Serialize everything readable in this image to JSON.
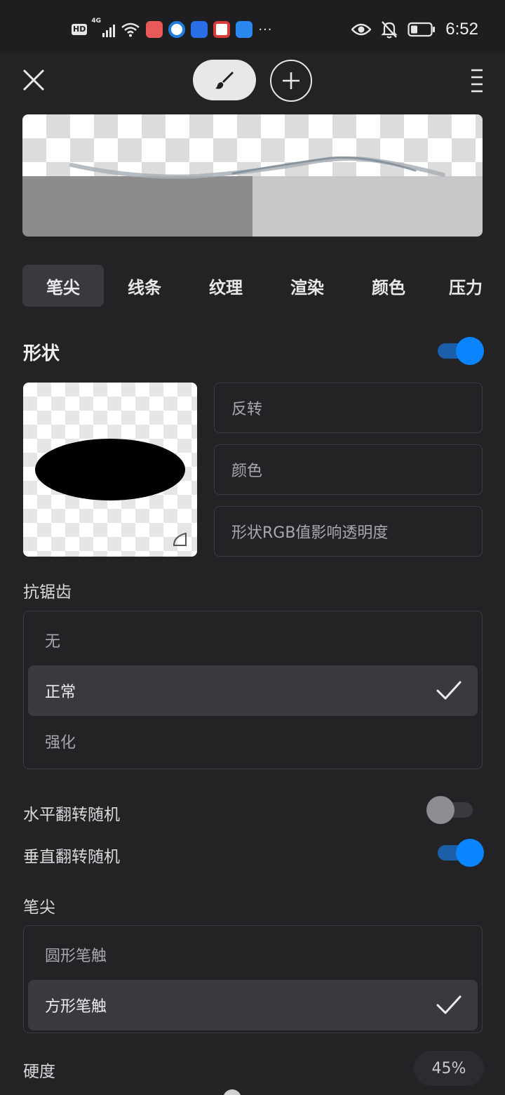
{
  "status_bar": {
    "hd": "HD",
    "network": "4G",
    "more": "···",
    "time": "6:52",
    "app_icons": [
      {
        "name": "mail-app-icon",
        "color": "#e85a5a"
      },
      {
        "name": "browser-app-icon",
        "color": "#1f7fe0"
      },
      {
        "name": "bulb-app-icon",
        "color": "#2a6fe8"
      },
      {
        "name": "book-app-icon",
        "color": "#d93a3a"
      },
      {
        "name": "weather-app-icon",
        "color": "#2a88ee"
      }
    ]
  },
  "tabs": [
    {
      "label": "笔尖",
      "active": true
    },
    {
      "label": "线条",
      "active": false
    },
    {
      "label": "纹理",
      "active": false
    },
    {
      "label": "渲染",
      "active": false
    },
    {
      "label": "颜色",
      "active": false
    },
    {
      "label": "压力",
      "active": false
    }
  ],
  "shape": {
    "title": "形状",
    "enabled": true,
    "options": [
      "反转",
      "颜色",
      "形状RGB值影响透明度"
    ]
  },
  "antialias": {
    "title": "抗锯齿",
    "options": [
      "无",
      "正常",
      "强化"
    ],
    "selected": "正常"
  },
  "flip": {
    "horizontal_label": "水平翻转随机",
    "horizontal_on": false,
    "vertical_label": "垂直翻转随机",
    "vertical_on": true
  },
  "tip": {
    "title": "笔尖",
    "options": [
      "圆形笔触",
      "方形笔触"
    ],
    "selected": "方形笔触"
  },
  "hardness": {
    "label": "硬度",
    "value": "45%"
  },
  "colors": {
    "accent": "#0a84ff",
    "background": "#232326"
  }
}
